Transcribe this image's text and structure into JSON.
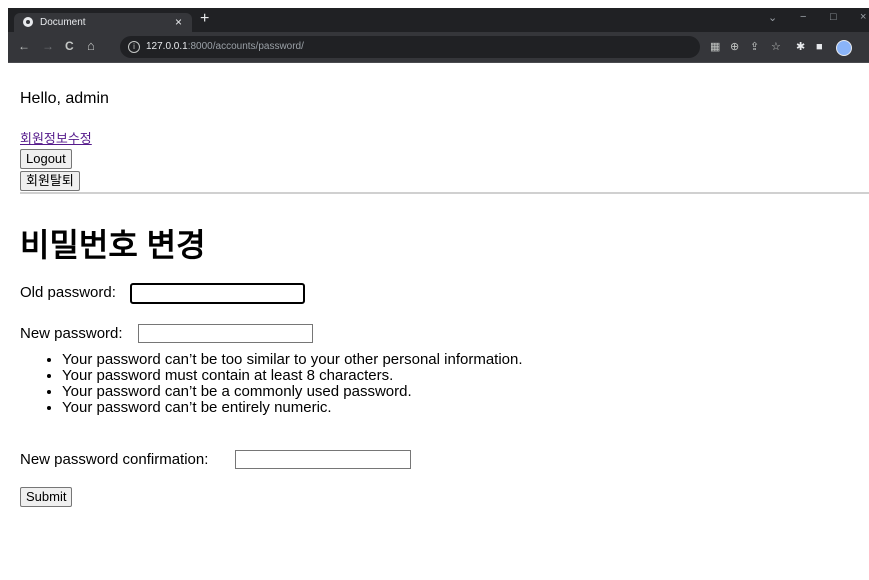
{
  "browser": {
    "tab_title": "Document",
    "tab_close": "×",
    "new_tab": "+",
    "url_host": "127.0.0.1",
    "url_path": ":8000/accounts/password/",
    "nav_back": "←",
    "nav_forward": "→",
    "nav_reload": "C",
    "nav_home": "⌂",
    "win_chevron": "⌄",
    "win_min": "−",
    "win_max": "□",
    "win_close": "×"
  },
  "header": {
    "greeting": "Hello, admin",
    "edit_profile_link": "회원정보수정",
    "logout_button": "Logout",
    "withdraw_button": "회원탈퇴"
  },
  "form": {
    "title": "비밀번호 변경",
    "old_password_label": "Old password:",
    "old_password_value": "",
    "new_password_label": "New password:",
    "new_password_value": "",
    "help_items": [
      "Your password can’t be too similar to your other personal information.",
      "Your password must contain at least 8 characters.",
      "Your password can’t be a commonly used password.",
      "Your password can’t be entirely numeric."
    ],
    "confirm_label": "New password confirmation:",
    "confirm_value": "",
    "submit_button": "Submit"
  }
}
